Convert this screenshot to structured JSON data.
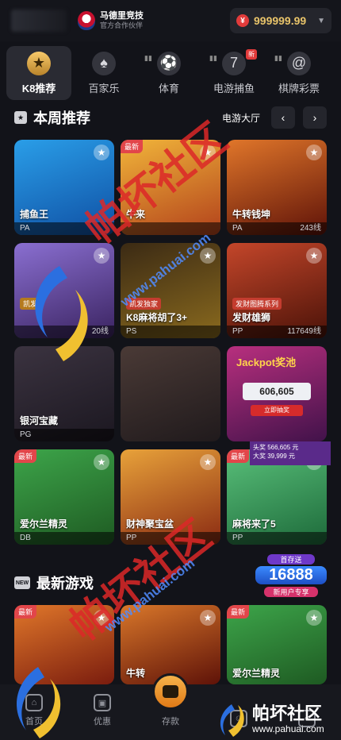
{
  "header": {
    "sponsor_title": "马德里竞技",
    "sponsor_subtitle": "官方合作伙伴",
    "balance": "999999.99",
    "currency_symbol": "¥"
  },
  "categories": [
    {
      "label": "K8推荐",
      "icon": "medal-icon",
      "glyph": "★"
    },
    {
      "label": "百家乐",
      "icon": "dealer-icon",
      "glyph": "♠"
    },
    {
      "label": "体育",
      "icon": "soccer-ball-icon",
      "glyph": "⚽"
    },
    {
      "label": "电游捕鱼",
      "icon": "slot-seven-icon",
      "glyph": "7",
      "badge": "新"
    },
    {
      "label": "棋牌彩票",
      "icon": "poker-chip-icon",
      "glyph": "@"
    }
  ],
  "weekly": {
    "icon_text": "★",
    "title": "本周推荐",
    "link": "电游大厅",
    "prev": "‹",
    "next": "›"
  },
  "weekly_games": [
    {
      "name": "捕鱼王",
      "provider": "PA",
      "lines": "",
      "tag": "",
      "chip": ""
    },
    {
      "name": "牛来",
      "provider": "",
      "lines": "",
      "tag": "最新",
      "chip": ""
    },
    {
      "name": "牛转钱坤",
      "provider": "PA",
      "lines": "243线",
      "tag": "",
      "chip": ""
    },
    {
      "name": "",
      "provider": "",
      "lines": "20线",
      "tag": "",
      "chip": "凯发"
    },
    {
      "name": "K8麻将胡了3+",
      "provider": "PS",
      "lines": "",
      "tag": "",
      "chip": "凯发独家"
    },
    {
      "name": "发财雄狮",
      "provider": "PP",
      "lines": "117649线",
      "tag": "",
      "chip": "发财图腾系列"
    },
    {
      "name": "银河宝藏",
      "provider": "PG",
      "lines": "",
      "tag": "",
      "chip": ""
    },
    {
      "name": "",
      "provider": "",
      "lines": "",
      "tag": "",
      "chip": ""
    },
    {
      "name": "",
      "provider": "",
      "lines": "",
      "tag": "",
      "chip": ""
    },
    {
      "name": "爱尔兰精灵",
      "provider": "DB",
      "lines": "",
      "tag": "最新",
      "chip": ""
    },
    {
      "name": "财神聚宝盆",
      "provider": "PP",
      "lines": "",
      "tag": "",
      "chip": ""
    },
    {
      "name": "麻将来了5",
      "provider": "PP",
      "lines": "",
      "tag": "最新",
      "chip": ""
    }
  ],
  "jackpot": {
    "title": "Jackpot奖池",
    "amount": "606,605",
    "button": "立即抽奖",
    "row1_label": "头奖",
    "row1_value": "566,605",
    "row2_label": "大奖",
    "row2_value": "39,999",
    "unit": "元"
  },
  "newest": {
    "icon_text": "NEW",
    "title": "最新游戏"
  },
  "newest_games": [
    {
      "name": "",
      "provider": "",
      "tag": "最新"
    },
    {
      "name": "牛转",
      "provider": "",
      "tag": ""
    },
    {
      "name": "爱尔兰精灵",
      "provider": "",
      "tag": "最新"
    }
  ],
  "promo": {
    "top": "首存送",
    "amount": "16888",
    "button": "新用户专享"
  },
  "bottom_nav": [
    {
      "label": "首页",
      "icon": "home-icon"
    },
    {
      "label": "优惠",
      "icon": "gift-icon"
    },
    {
      "label": "存款",
      "icon": "wallet-icon"
    },
    {
      "label": "",
      "icon": "service-icon"
    },
    {
      "label": "",
      "icon": "user-icon"
    }
  ],
  "watermark": {
    "text": "帕坏社区",
    "url": "www.pahuai.com",
    "corner_name": "帕坏社区",
    "corner_url": "www.pahuai.com"
  }
}
